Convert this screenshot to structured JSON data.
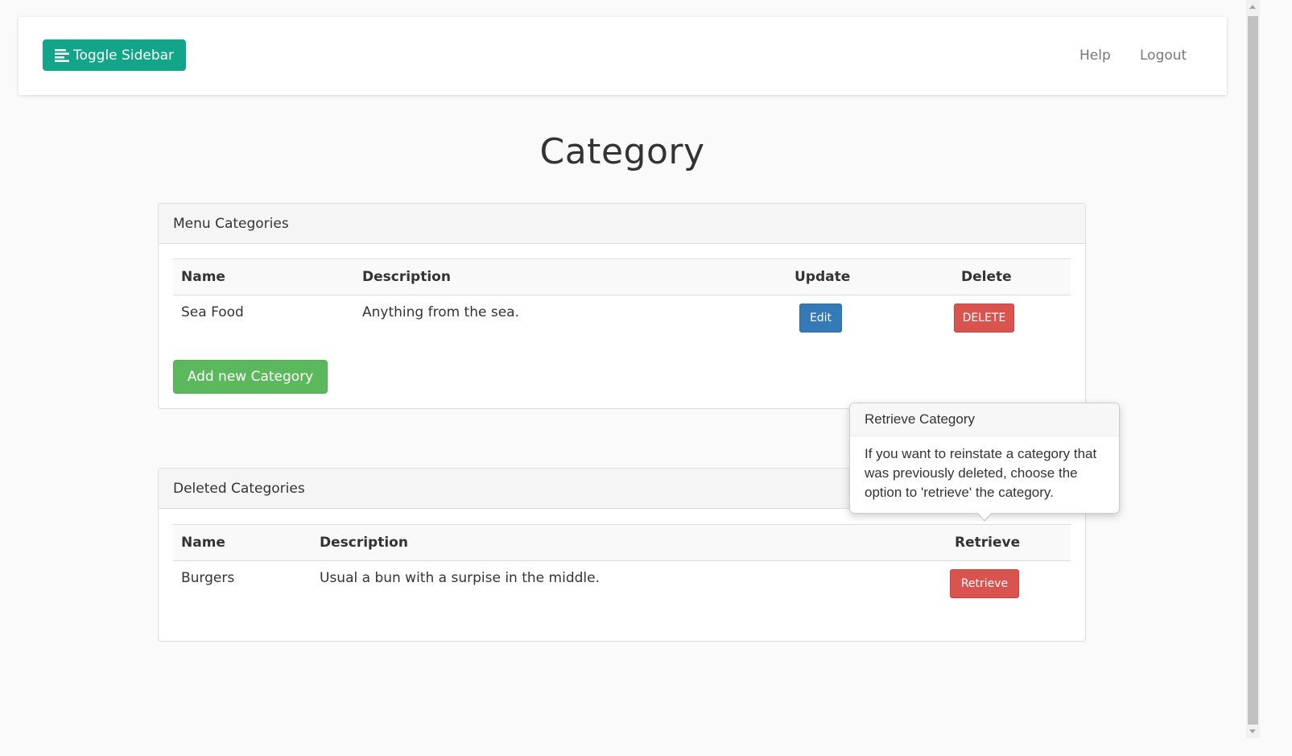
{
  "navbar": {
    "toggle_label": "Toggle Sidebar",
    "help_label": "Help",
    "logout_label": "Logout"
  },
  "page": {
    "title": "Category"
  },
  "menu_panel": {
    "heading": "Menu Categories",
    "columns": {
      "name": "Name",
      "description": "Description",
      "update": "Update",
      "delete": "Delete"
    },
    "rows": [
      {
        "name": "Sea Food",
        "description": "Anything from the sea.",
        "edit_label": "Edit",
        "delete_label": "DELETE"
      }
    ],
    "add_label": "Add new Category"
  },
  "deleted_panel": {
    "heading": "Deleted Categories",
    "columns": {
      "name": "Name",
      "description": "Description",
      "retrieve": "Retrieve"
    },
    "rows": [
      {
        "name": "Burgers",
        "description": "Usual a bun with a surpise in the middle.",
        "retrieve_label": "Retrieve"
      }
    ]
  },
  "popover": {
    "title": "Retrieve Category",
    "content": "If you want to reinstate a category that was previously deleted, choose the option to 'retrieve' the category."
  },
  "colors": {
    "toggle": "#12a58a",
    "edit": "#337ab7",
    "delete": "#d9534f",
    "add": "#5cb85c"
  },
  "icons": {
    "toggle": "align-left-icon"
  }
}
